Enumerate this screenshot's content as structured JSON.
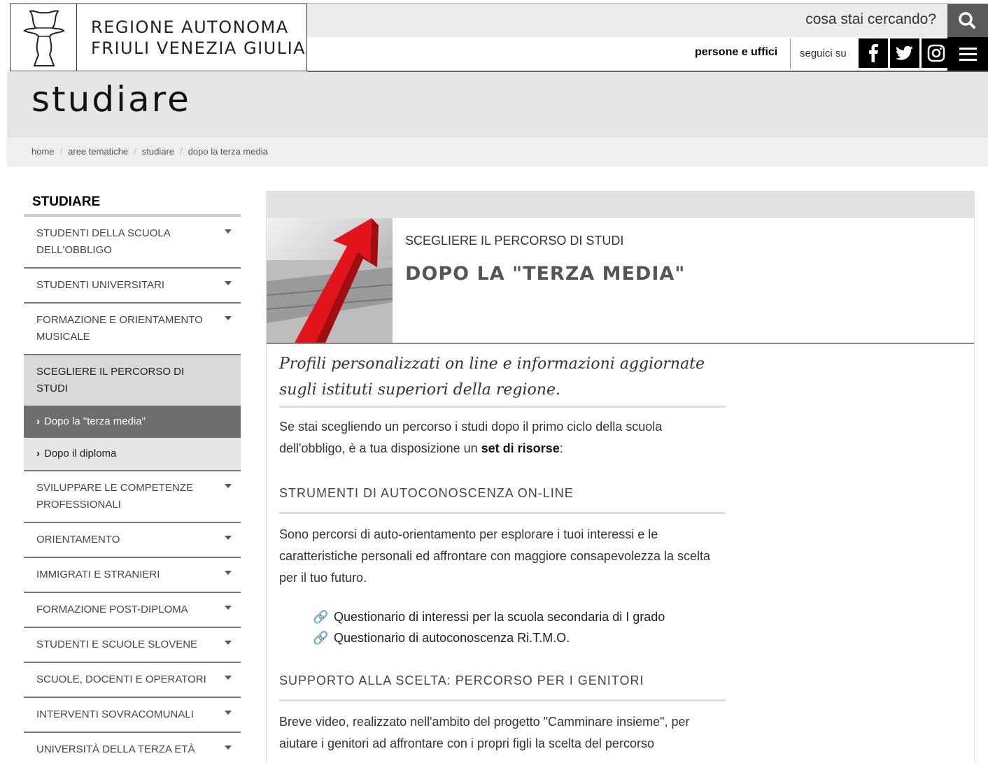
{
  "header": {
    "org_name_line1": "REGIONE AUTONOMA",
    "org_name_line2": "FRIULI VENEZIA GIULIA",
    "search_placeholder": "cosa stai cercando?",
    "people_link": "persone e uffici",
    "follow_label": "seguici su",
    "social": [
      "facebook-icon",
      "twitter-icon",
      "instagram-icon"
    ]
  },
  "page": {
    "title": "studiare",
    "breadcrumb": [
      "home",
      "aree tematiche",
      "studiare",
      "dopo la terza media"
    ]
  },
  "sidebar": {
    "title": "STUDIARE",
    "items": [
      {
        "label": "STUDENTI DELLA SCUOLA DELL'OBBLIGO"
      },
      {
        "label": "STUDENTI UNIVERSITARI"
      },
      {
        "label": "FORMAZIONE E ORIENTAMENTO MUSICALE"
      },
      {
        "label": "SCEGLIERE IL PERCORSO DI STUDI"
      },
      {
        "label": "SVILUPPARE LE COMPETENZE PROFESSIONALI"
      },
      {
        "label": "ORIENTAMENTO"
      },
      {
        "label": "IMMIGRATI E STRANIERI"
      },
      {
        "label": "FORMAZIONE POST-DIPLOMA"
      },
      {
        "label": "STUDENTI E SCUOLE SLOVENE"
      },
      {
        "label": "SCUOLE, DOCENTI E OPERATORI"
      },
      {
        "label": "INTERVENTI SOVRACOMUNALI"
      },
      {
        "label": "UNIVERSITÀ DELLA TERZA ETÀ"
      }
    ],
    "subitems": [
      "Dopo la \"terza media\"",
      "Dopo il diploma"
    ]
  },
  "main": {
    "subtitle": "SCEGLIERE IL PERCORSO DI STUDI",
    "title": "DOPO LA \"TERZA MEDIA\"",
    "lead": "Profili personalizzati on line e informazioni aggiornate sugli istituti superiori della regione.",
    "intro_pre": "Se stai scegliendo un percorso i studi dopo il primo ciclo della scuola dell'obbligo, è a tua disposizione un ",
    "intro_bold": "set di risorse",
    "intro_post": ":",
    "section1_title": "STRUMENTI DI AUTOCONOSCENZA ON-LINE",
    "section1_text": "Sono percorsi di auto-orientamento per esplorare i tuoi interessi e le caratteristiche personali ed affrontare con maggiore consapevolezza la scelta per il tuo futuro.",
    "links": [
      "Questionario di interessi per la scuola secondaria di I grado",
      "Questionario di autoconoscenza Ri.T.M.O."
    ],
    "section2_title": "SUPPORTO ALLA SCELTA: PERCORSO PER I GENITORI",
    "section2_text": "Breve video, realizzato nell'ambito del progetto \"Camminare insieme\", per aiutare i genitori ad affrontare con i propri figli la scelta del percorso"
  }
}
